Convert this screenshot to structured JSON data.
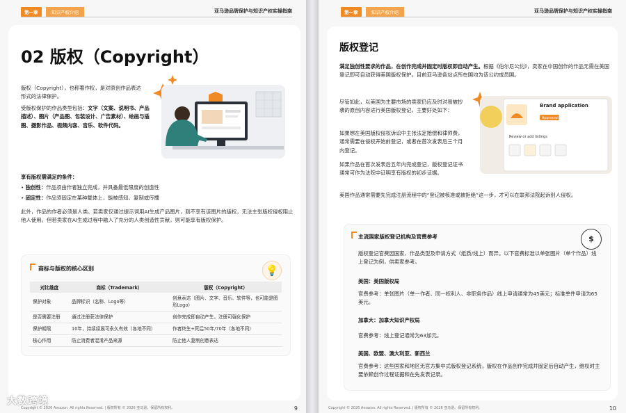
{
  "header": {
    "chapter": "第一章",
    "section": "知识产权介绍",
    "book_title": "亚马逊品牌保护与知识产权实操指南"
  },
  "left": {
    "title": "02 版权（Copyright）",
    "intro": "版权（Copyright），也称著作权，是对原创作品表达形式的法律保护。",
    "types_lead": "受版权保护的作品类型包括：",
    "types_bold": "文字（文案、说明书、产品描述）、图片（产品图、包装设计、广告素材）、绘画与插图、摄影作品、视频内容、音乐、软件代码。",
    "conditions_title": "享有版权需满足的条件：",
    "cond1_label": "独创性：",
    "cond1_text": "作品须由作者独立完成，并具备最低限度的创造性",
    "cond2_label": "固定性：",
    "cond2_text": "作品须固定在某种载体上，能被感知、复制或传播",
    "ai_note": "此外，作品的作者必须是人类。若卖家仅通过提示词用AI生成产品图片，则不享有该图片的版权，无法主张版权侵权阻止他人使用。但若卖家在AI生成过程中融入了充分的人类创造性贡献，则可能享有版权保护。",
    "table_title": "商标与版权的核心区别",
    "table": {
      "headers": [
        "对比维度",
        "商标（Trademark）",
        "版权（Copyright）"
      ],
      "rows": [
        [
          "保护对象",
          "品牌标识（名称、Logo等）",
          "创意表达（图片、文字、音乐、软件等，也可能是图形Logo）"
        ],
        [
          "是否需要注册",
          "通过注册获法律保护",
          "创作完成即自动产生，注册可强化保护"
        ],
        [
          "保护期限",
          "10年，持续续展可永久有效（各地不同）",
          "作者终生+死后50年/70年（各地不同）"
        ],
        [
          "核心作用",
          "防止消费者混淆产品来源",
          "防止他人复制创意表达"
        ]
      ]
    },
    "footer": "Copyright © 2026 Amazon. All rights Reserved. | 版权所有 © 2026 亚马逊。保留所有权利。",
    "page_number": "9"
  },
  "right": {
    "title": "版权登记",
    "p1_bold": "满足独创性要求的作品，在创作完成并固定时版权即自动产生。",
    "p1_text": "根据《伯尔尼公约》，卖家在中国创作的作品无需在美国登记即可自动获得美国版权保护。目前亚马逊各站点所在国均为该公约成员国。",
    "p2": "尽管如此，以美国为主要市场的卖家仍应及时对易被抄袭的原创内容进行美国版权登记，主要好处如下：",
    "p3": "如果想在美国版权侵权诉讼中主张法定赔偿和律师费，通常需要在侵权开始前登记，或者在首次发表后三个月内登记。",
    "p4": "如果作品在首次发表后五年内完成登记，版权登记证书通常可作为法院中证明享有版权的初步证据。",
    "p5": "美国作品通常需要先完成注册流程中的“登记被核准或被拒绝”这一步，才可以在联邦法院起诉别人侵权。",
    "illus": {
      "card_title": "Brand application",
      "card_badge": "Approved",
      "card_sub": "Review or add listings"
    },
    "box_title": "主流国家版权登记机构及官费参考",
    "box_intro": "版权登记官费因国家、作品类型及申请方式（纸质/线上）而异。以下官费标准以单张图片（单个作品）线上登记为例，供卖家参考。",
    "us_title": "美国：美国版权局",
    "us_fee": "官费参考：单张图片（单一作者、同一权利人、非职务作品）线上申请通常为45美元；标准单件申请为65美元。",
    "ca_title": "加拿大：加拿大知识产权局",
    "ca_fee": "官费参考：线上登记通常为63加元。",
    "eu_title": "美国、欧盟、澳大利亚、新西兰",
    "eu_fee": "官费参考：这些国家和地区无官方集中式版权登记系统，版权在作品创作完成并固定后自动产生，维权时主要依赖创作过程证据和在先发表记录。",
    "footer": "Copyright © 2026 Amazon. All rights Reserved. | 版权所有 © 2026 亚马逊。保留所有权利。",
    "page_number": "10"
  },
  "watermark": "大数跨境"
}
